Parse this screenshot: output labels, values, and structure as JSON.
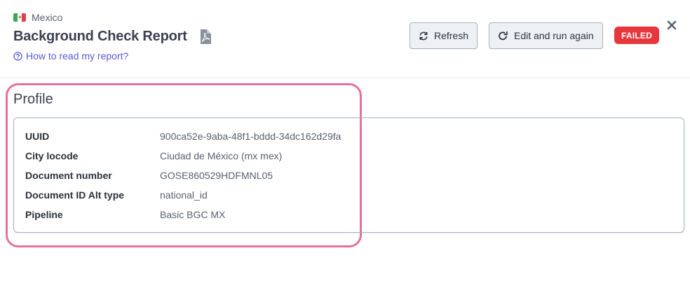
{
  "header": {
    "country": "Mexico",
    "title": "Background Check Report",
    "help_link": "How to read my report?",
    "refresh_label": "Refresh",
    "edit_label": "Edit and run again",
    "status": "FAILED",
    "status_color": "#e8363c",
    "flag_colors": [
      "#3aa65a",
      "#f4f4f4",
      "#e2404c"
    ],
    "icons": {
      "flag": "mexico-flag-icon",
      "pdf": "pdf-file-icon",
      "help": "question-circle-icon",
      "refresh": "refresh-icon",
      "edit": "rotate-right-icon",
      "close": "close-icon"
    }
  },
  "profile": {
    "title": "Profile",
    "highlight_color": "#e6709e",
    "fields": [
      {
        "label": "UUID",
        "value": "900ca52e-9aba-48f1-bddd-34dc162d29fa"
      },
      {
        "label": "City locode",
        "value": "Ciudad de México (mx mex)"
      },
      {
        "label": "Document number",
        "value": "GOSE860529HDFMNL05"
      },
      {
        "label": "Document ID Alt type",
        "value": "national_id"
      },
      {
        "label": "Pipeline",
        "value": "Basic BGC MX"
      }
    ]
  }
}
